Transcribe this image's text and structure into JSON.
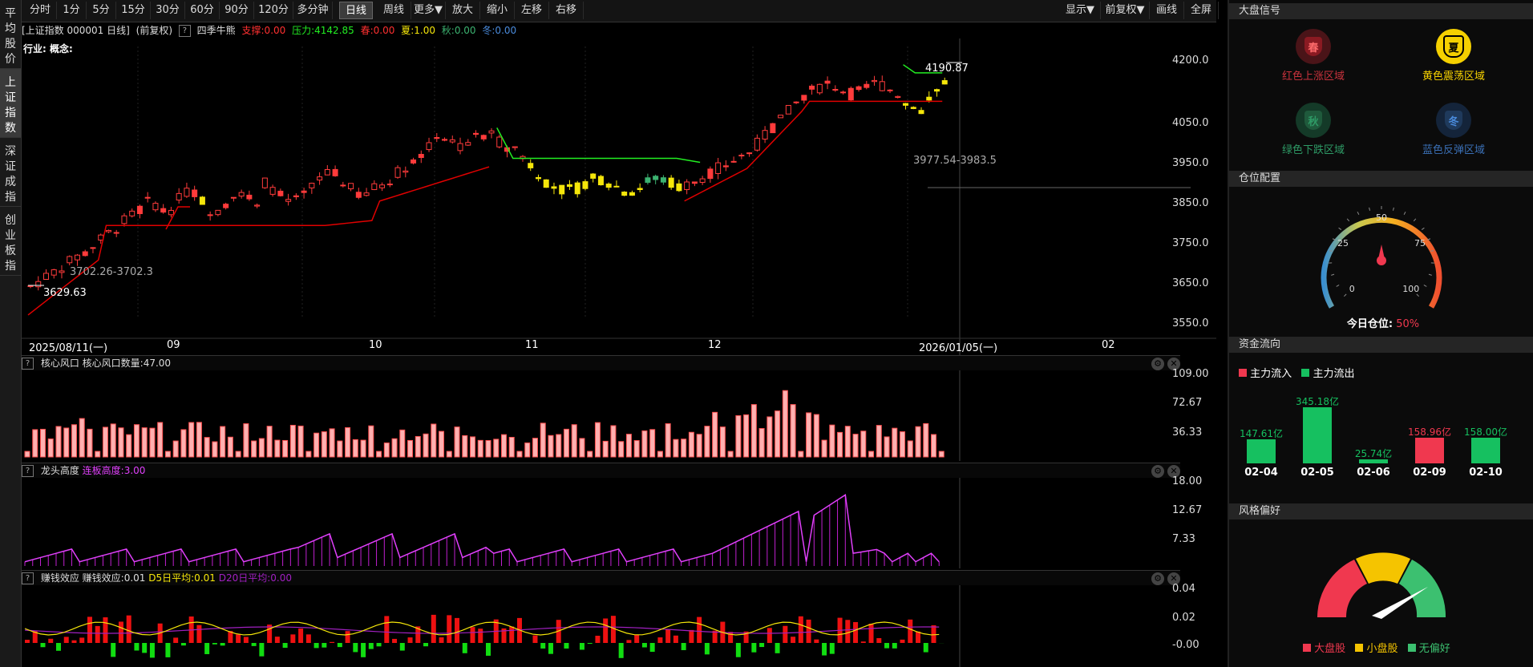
{
  "left_tabs": [
    "平均股价",
    "上证指数",
    "深证成指",
    "创业板指"
  ],
  "toolbar": {
    "periods": [
      "分时",
      "1分",
      "5分",
      "15分",
      "30分",
      "60分",
      "90分",
      "120分",
      "多分钟",
      "日线",
      "周线",
      "更多▼",
      "放大",
      "缩小",
      "左移",
      "右移"
    ],
    "right_buttons": [
      "显示▼",
      "前复权▼",
      "画线",
      "全屏"
    ]
  },
  "info": {
    "symbol": "[上证指数 000001 日线]",
    "adjust": "(前复权)",
    "indicator": "四季牛熊",
    "support": "支撑:0.00",
    "pressure": "压力:4142.85",
    "spring": "春:0.00",
    "summer": "夏:1.00",
    "autumn": "秋:0.00",
    "winter": "冬:0.00",
    "industry": "行业: 概念:"
  },
  "main_chart": {
    "y_ticks": [
      "4200.0",
      "4050.0",
      "3950.0",
      "3850.0",
      "3750.0",
      "3650.0",
      "3550.0"
    ],
    "x_labels": [
      "2025/08/11(一)",
      "09",
      "10",
      "11",
      "12",
      "2026/01/05(一)",
      "02"
    ],
    "annotations": {
      "high": "4190.87",
      "low": "3629.63",
      "band1": "3702.26-3702.3",
      "band2": "3977.54-3983.5"
    },
    "colors": {
      "up": "#ff3b3b",
      "down_yellow": "#f5e60a",
      "down_green": "#3cb371",
      "support": "#e00000",
      "pressure": "#22ee22"
    }
  },
  "sub1": {
    "title": "核心风口",
    "label": "核心风口数量:47.00",
    "ticks": [
      "109.00",
      "72.67",
      "36.33"
    ]
  },
  "sub2": {
    "title": "龙头高度",
    "label": "连板高度:3.00",
    "ticks": [
      "18.00",
      "12.67",
      "7.33"
    ]
  },
  "sub3": {
    "title": "赚钱效应",
    "label": "赚钱效应:0.01",
    "d5": "D5日平均:0.01",
    "d20": "D20日平均:0.00",
    "ticks": [
      "0.04",
      "0.02",
      "-0.00"
    ]
  },
  "right_panel": {
    "signal_title": "大盘信号",
    "seasons": [
      {
        "char": "春",
        "label": "红色上涨区域",
        "color": "#c8323c",
        "active": false
      },
      {
        "char": "夏",
        "label": "黄色震荡区域",
        "color": "#f5d000",
        "active": true
      },
      {
        "char": "秋",
        "label": "绿色下跌区域",
        "color": "#2e9b66",
        "active": false
      },
      {
        "char": "冬",
        "label": "蓝色反弹区域",
        "color": "#3a6fb5",
        "active": false
      }
    ],
    "position_title": "仓位配置",
    "gauge_ticks": [
      "0",
      "25",
      "50",
      "75",
      "100"
    ],
    "position_label": "今日仓位:",
    "position_value": "50%",
    "position_level": 50,
    "flow_title": "资金流向",
    "flow_legend": {
      "in": "主力流入",
      "out": "主力流出"
    },
    "flows": [
      {
        "date": "02-04",
        "value": "147.61亿",
        "amount": 147.61,
        "dir": "out"
      },
      {
        "date": "02-05",
        "value": "345.18亿",
        "amount": 345.18,
        "dir": "out"
      },
      {
        "date": "02-06",
        "value": "25.74亿",
        "amount": 25.74,
        "dir": "out"
      },
      {
        "date": "02-09",
        "value": "158.96亿",
        "amount": 158.96,
        "dir": "in"
      },
      {
        "date": "02-10",
        "value": "158.00亿",
        "amount": 158.0,
        "dir": "out"
      }
    ],
    "style_title": "风格偏好",
    "style_legend": [
      {
        "label": "大盘股",
        "color": "#f0384f"
      },
      {
        "label": "小盘股",
        "color": "#f5c400"
      },
      {
        "label": "无偏好",
        "color": "#3cc070"
      }
    ]
  }
}
